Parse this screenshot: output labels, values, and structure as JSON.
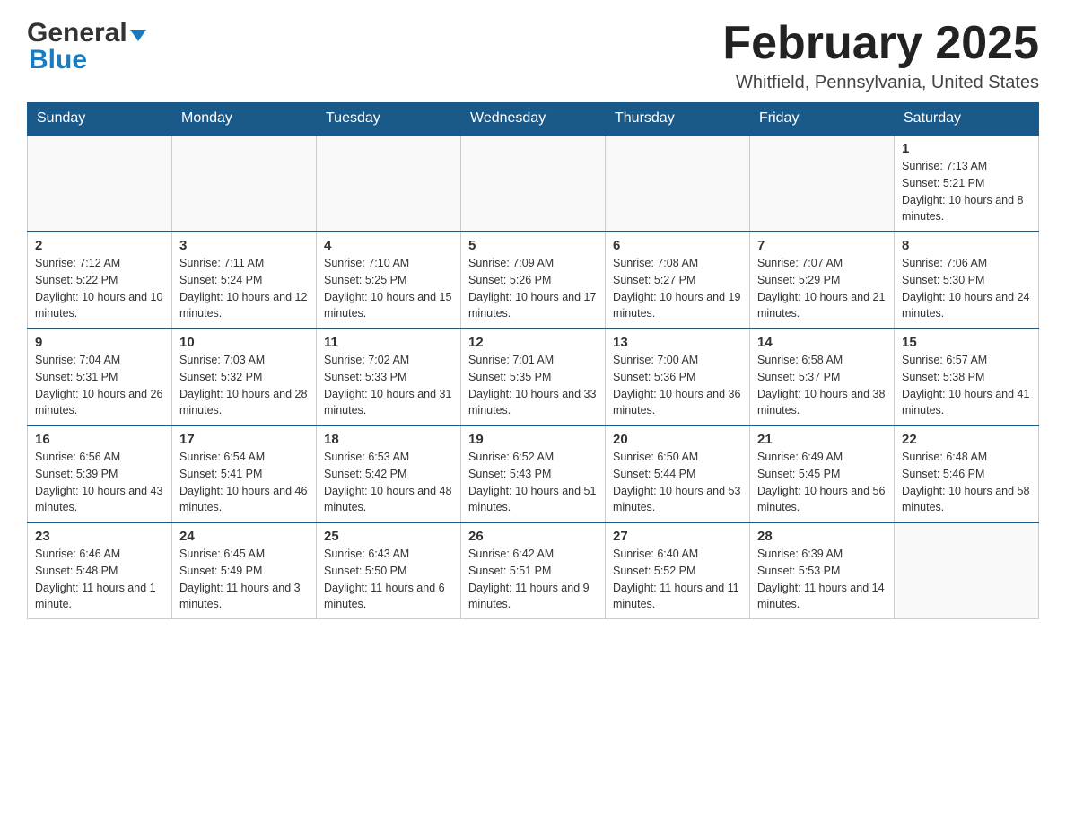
{
  "header": {
    "logo_general": "General",
    "logo_blue": "Blue",
    "month_title": "February 2025",
    "location": "Whitfield, Pennsylvania, United States"
  },
  "weekdays": [
    "Sunday",
    "Monday",
    "Tuesday",
    "Wednesday",
    "Thursday",
    "Friday",
    "Saturday"
  ],
  "weeks": [
    [
      {
        "day": "",
        "info": ""
      },
      {
        "day": "",
        "info": ""
      },
      {
        "day": "",
        "info": ""
      },
      {
        "day": "",
        "info": ""
      },
      {
        "day": "",
        "info": ""
      },
      {
        "day": "",
        "info": ""
      },
      {
        "day": "1",
        "info": "Sunrise: 7:13 AM\nSunset: 5:21 PM\nDaylight: 10 hours and 8 minutes."
      }
    ],
    [
      {
        "day": "2",
        "info": "Sunrise: 7:12 AM\nSunset: 5:22 PM\nDaylight: 10 hours and 10 minutes."
      },
      {
        "day": "3",
        "info": "Sunrise: 7:11 AM\nSunset: 5:24 PM\nDaylight: 10 hours and 12 minutes."
      },
      {
        "day": "4",
        "info": "Sunrise: 7:10 AM\nSunset: 5:25 PM\nDaylight: 10 hours and 15 minutes."
      },
      {
        "day": "5",
        "info": "Sunrise: 7:09 AM\nSunset: 5:26 PM\nDaylight: 10 hours and 17 minutes."
      },
      {
        "day": "6",
        "info": "Sunrise: 7:08 AM\nSunset: 5:27 PM\nDaylight: 10 hours and 19 minutes."
      },
      {
        "day": "7",
        "info": "Sunrise: 7:07 AM\nSunset: 5:29 PM\nDaylight: 10 hours and 21 minutes."
      },
      {
        "day": "8",
        "info": "Sunrise: 7:06 AM\nSunset: 5:30 PM\nDaylight: 10 hours and 24 minutes."
      }
    ],
    [
      {
        "day": "9",
        "info": "Sunrise: 7:04 AM\nSunset: 5:31 PM\nDaylight: 10 hours and 26 minutes."
      },
      {
        "day": "10",
        "info": "Sunrise: 7:03 AM\nSunset: 5:32 PM\nDaylight: 10 hours and 28 minutes."
      },
      {
        "day": "11",
        "info": "Sunrise: 7:02 AM\nSunset: 5:33 PM\nDaylight: 10 hours and 31 minutes."
      },
      {
        "day": "12",
        "info": "Sunrise: 7:01 AM\nSunset: 5:35 PM\nDaylight: 10 hours and 33 minutes."
      },
      {
        "day": "13",
        "info": "Sunrise: 7:00 AM\nSunset: 5:36 PM\nDaylight: 10 hours and 36 minutes."
      },
      {
        "day": "14",
        "info": "Sunrise: 6:58 AM\nSunset: 5:37 PM\nDaylight: 10 hours and 38 minutes."
      },
      {
        "day": "15",
        "info": "Sunrise: 6:57 AM\nSunset: 5:38 PM\nDaylight: 10 hours and 41 minutes."
      }
    ],
    [
      {
        "day": "16",
        "info": "Sunrise: 6:56 AM\nSunset: 5:39 PM\nDaylight: 10 hours and 43 minutes."
      },
      {
        "day": "17",
        "info": "Sunrise: 6:54 AM\nSunset: 5:41 PM\nDaylight: 10 hours and 46 minutes."
      },
      {
        "day": "18",
        "info": "Sunrise: 6:53 AM\nSunset: 5:42 PM\nDaylight: 10 hours and 48 minutes."
      },
      {
        "day": "19",
        "info": "Sunrise: 6:52 AM\nSunset: 5:43 PM\nDaylight: 10 hours and 51 minutes."
      },
      {
        "day": "20",
        "info": "Sunrise: 6:50 AM\nSunset: 5:44 PM\nDaylight: 10 hours and 53 minutes."
      },
      {
        "day": "21",
        "info": "Sunrise: 6:49 AM\nSunset: 5:45 PM\nDaylight: 10 hours and 56 minutes."
      },
      {
        "day": "22",
        "info": "Sunrise: 6:48 AM\nSunset: 5:46 PM\nDaylight: 10 hours and 58 minutes."
      }
    ],
    [
      {
        "day": "23",
        "info": "Sunrise: 6:46 AM\nSunset: 5:48 PM\nDaylight: 11 hours and 1 minute."
      },
      {
        "day": "24",
        "info": "Sunrise: 6:45 AM\nSunset: 5:49 PM\nDaylight: 11 hours and 3 minutes."
      },
      {
        "day": "25",
        "info": "Sunrise: 6:43 AM\nSunset: 5:50 PM\nDaylight: 11 hours and 6 minutes."
      },
      {
        "day": "26",
        "info": "Sunrise: 6:42 AM\nSunset: 5:51 PM\nDaylight: 11 hours and 9 minutes."
      },
      {
        "day": "27",
        "info": "Sunrise: 6:40 AM\nSunset: 5:52 PM\nDaylight: 11 hours and 11 minutes."
      },
      {
        "day": "28",
        "info": "Sunrise: 6:39 AM\nSunset: 5:53 PM\nDaylight: 11 hours and 14 minutes."
      },
      {
        "day": "",
        "info": ""
      }
    ]
  ]
}
